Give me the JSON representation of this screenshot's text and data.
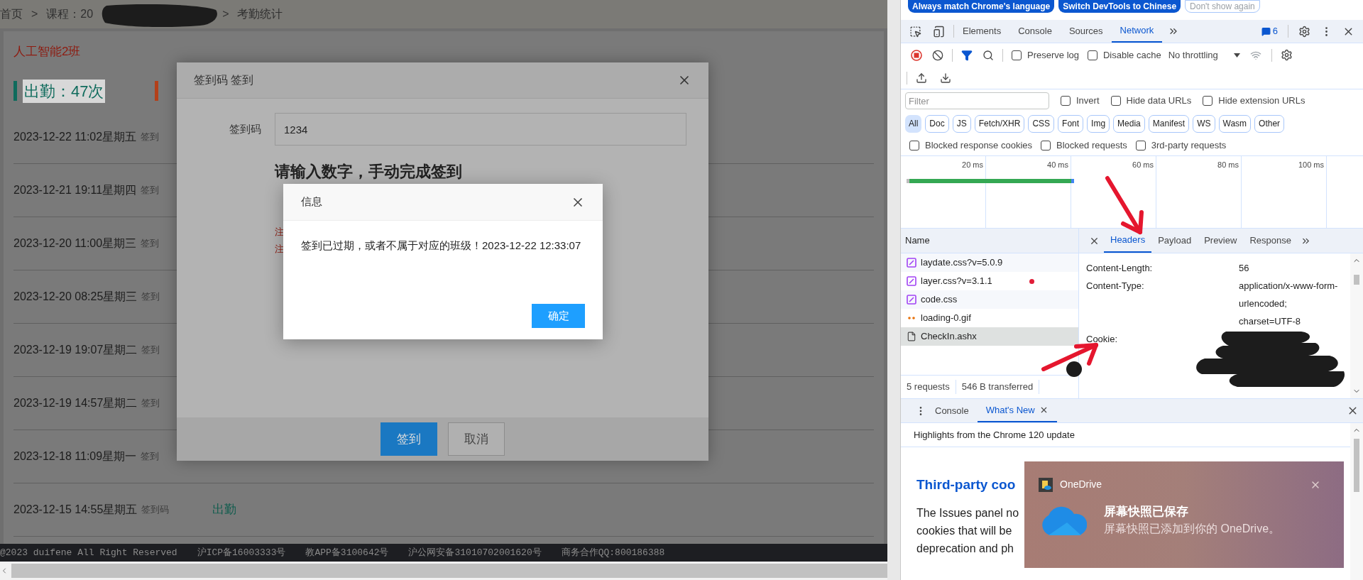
{
  "page": {
    "breadcrumb": [
      "首页",
      "课程：20",
      "考勤统计"
    ],
    "separator": ">",
    "class_name": "人工智能2班",
    "stats": [
      {
        "label": "出勤：47次",
        "color": "#0f6b5c"
      },
      {
        "color": "#b3401a"
      }
    ],
    "records": [
      {
        "time": "2023-12-22 11:02星期五",
        "code": "签到"
      },
      {
        "time": "2023-12-21 19:11星期四",
        "code": "签到"
      },
      {
        "time": "2023-12-20 11:00星期三",
        "code": "签到"
      },
      {
        "time": "2023-12-20 08:25星期三",
        "code": "签到"
      },
      {
        "time": "2023-12-19 19:07星期二",
        "code": "签到"
      },
      {
        "time": "2023-12-19 14:57星期二",
        "code": "签到"
      },
      {
        "time": "2023-12-18 11:09星期一",
        "code": "签到"
      },
      {
        "time": "2023-12-15 14:55星期五",
        "code": "签到码",
        "status": "出勤"
      }
    ],
    "footer": [
      "@2023 duifene All Right Reserved",
      "沪ICP备16003333号",
      "教APP备3100642号",
      "沪公网安备31010702001620号",
      "商务合作QQ:800186388"
    ]
  },
  "checkin_dialog": {
    "title": "签到码 签到",
    "field": {
      "label": "签到码",
      "value": "1234"
    },
    "heading": "请输入数字，手动完成签到",
    "notes": [
      "注",
      "注"
    ],
    "buttons": [
      {
        "label": "签到",
        "primary": true
      },
      {
        "label": "取消",
        "primary": false
      }
    ]
  },
  "message_dialog": {
    "title": "信息",
    "message": "签到已过期，或者不属于对应的班级！2023-12-22 12:33:07",
    "button": "确定"
  },
  "devtools": {
    "language_bar": [
      {
        "label": "Always match Chrome's language",
        "primary": true
      },
      {
        "label": "Switch DevTools to Chinese",
        "primary": true
      },
      {
        "label": "Don't show again",
        "primary": false
      }
    ],
    "tabs": [
      {
        "label": "Elements",
        "selected": false
      },
      {
        "label": "Console",
        "selected": false
      },
      {
        "label": "Sources",
        "selected": false
      },
      {
        "label": "Network",
        "selected": true
      }
    ],
    "issues_count": "6",
    "toolbar": {
      "options": [
        {
          "label": "Preserve log",
          "checked": false
        },
        {
          "label": "Disable cache",
          "checked": false
        }
      ],
      "throttling": "No throttling"
    },
    "filter": {
      "placeholder": "Filter",
      "options": [
        {
          "label": "Invert",
          "checked": false
        },
        {
          "label": "Hide data URLs",
          "checked": false
        },
        {
          "label": "Hide extension URLs",
          "checked": false
        }
      ]
    },
    "types": [
      {
        "label": "All",
        "selected": true
      },
      {
        "label": "Doc",
        "selected": false
      },
      {
        "label": "JS",
        "selected": false
      },
      {
        "label": "Fetch/XHR",
        "selected": false
      },
      {
        "label": "CSS",
        "selected": false
      },
      {
        "label": "Font",
        "selected": false
      },
      {
        "label": "Img",
        "selected": false
      },
      {
        "label": "Media",
        "selected": false
      },
      {
        "label": "Manifest",
        "selected": false
      },
      {
        "label": "WS",
        "selected": false
      },
      {
        "label": "Wasm",
        "selected": false
      },
      {
        "label": "Other",
        "selected": false
      }
    ],
    "blocked": [
      {
        "label": "Blocked response cookies",
        "checked": false
      },
      {
        "label": "Blocked requests",
        "checked": false
      },
      {
        "label": "3rd-party requests",
        "checked": false
      }
    ],
    "timeline_ticks": [
      "20 ms",
      "40 ms",
      "60 ms",
      "80 ms",
      "100 ms"
    ],
    "requests": {
      "header": "Name",
      "rows": [
        {
          "name": "laydate.css?v=5.0.9",
          "kind": "css",
          "selected": false
        },
        {
          "name": "layer.css?v=3.1.1",
          "kind": "css",
          "selected": false
        },
        {
          "name": "code.css",
          "kind": "css",
          "selected": false
        },
        {
          "name": "loading-0.gif",
          "kind": "image",
          "selected": false
        },
        {
          "name": "CheckIn.ashx",
          "kind": "document",
          "selected": true
        }
      ],
      "summary": [
        "5 requests",
        "546 B transferred"
      ]
    },
    "detail": {
      "tabs": [
        {
          "label": "Headers",
          "selected": true
        },
        {
          "label": "Payload",
          "selected": false
        },
        {
          "label": "Preview",
          "selected": false
        },
        {
          "label": "Response",
          "selected": false
        }
      ],
      "headers": [
        {
          "name": "Content-Length:",
          "value": "56"
        },
        {
          "name": "Content-Type:",
          "value": "application/x-www-form-urlencoded; charset=UTF-8"
        },
        {
          "name": "Cookie:"
        }
      ]
    },
    "drawer": {
      "tabs": [
        {
          "label": "Console",
          "selected": false,
          "closable": false
        },
        {
          "label": "What's New",
          "selected": true,
          "closable": true
        }
      ],
      "subtitle": "Highlights from the Chrome 120 update",
      "heading": "Third-party coo",
      "paragraph": [
        "The Issues panel no",
        "cookies that will be",
        "deprecation and ph"
      ]
    }
  },
  "toast": {
    "app": "OneDrive",
    "title": "屏幕快照已保存",
    "message": "屏幕快照已添加到你的 OneDrive。"
  }
}
